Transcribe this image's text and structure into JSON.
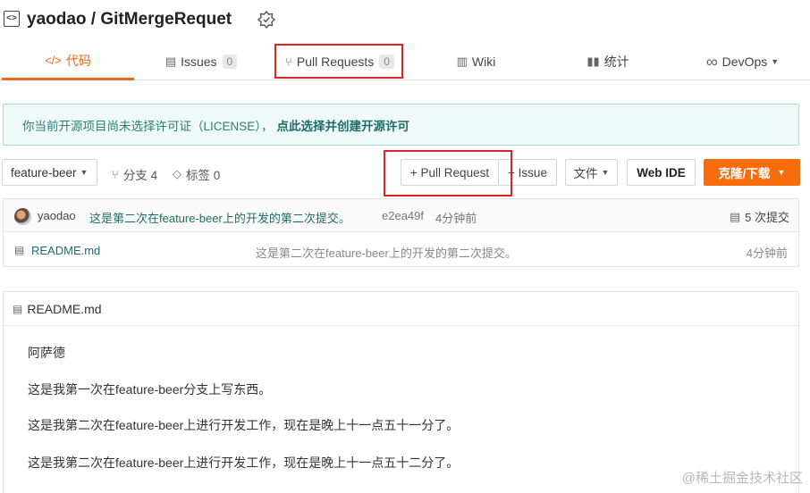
{
  "repo": {
    "owner": "yaodao",
    "name": "GitMergeRequet",
    "title": "yaodao / GitMergeRequet"
  },
  "tabs": [
    {
      "label": "代码",
      "icon": "code-icon",
      "active": true
    },
    {
      "label": "Issues",
      "icon": "issues-icon",
      "count": "0"
    },
    {
      "label": "Pull Requests",
      "icon": "pull-request-icon",
      "count": "0"
    },
    {
      "label": "Wiki",
      "icon": "wiki-icon"
    },
    {
      "label": "统计",
      "icon": "stats-icon"
    },
    {
      "label": "DevOps",
      "icon": "devops-icon",
      "dropdown": true
    }
  ],
  "license_notice": {
    "text": "你当前开源项目尚未选择许可证（LICENSE），",
    "link": "点此选择并创建开源许可"
  },
  "toolbar": {
    "branch": "feature-beer",
    "branches_label": "分支 4",
    "tags_label": "标签 0",
    "pull_request_button": "+ Pull Request",
    "issue_button": "+ Issue",
    "file_button": "文件",
    "webide_button": "Web IDE",
    "clone_button": "克隆/下载"
  },
  "last_commit": {
    "author": "yaodao",
    "message": "这是第二次在feature-beer上的开发的第二次提交。",
    "hash": "e2ea49f",
    "time": "4分钟前",
    "commit_count": "5 次提交"
  },
  "files": [
    {
      "name": "README.md",
      "message": "这是第二次在feature-beer上的开发的第二次提交。",
      "time": "4分钟前"
    }
  ],
  "readme": {
    "title": "README.md",
    "lines": [
      "阿萨德",
      "这是我第一次在feature-beer分支上写东西。",
      "这是我第二次在feature-beer上进行开发工作，现在是晚上十一点五十一分了。",
      "这是我第二次在feature-beer上进行开发工作，现在是晚上十一点五十二分了。"
    ]
  },
  "watermark": "@稀土掘金技术社区",
  "colors": {
    "accent": "#f0661a",
    "clone_button": "#f76d0e",
    "link": "#1f6d68",
    "highlight_box": "#e02424",
    "license_bg": "#eef9f8"
  }
}
